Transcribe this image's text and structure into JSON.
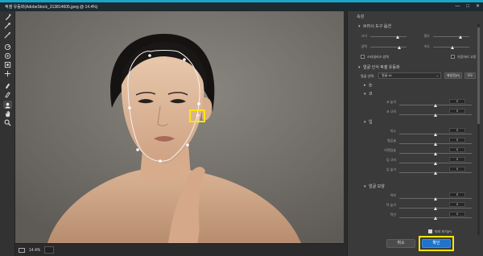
{
  "window": {
    "title": "픽셀 유동화(AdobeStock_313814605.jpeg @ 14.4%)",
    "controls": [
      "—",
      "□",
      "✕"
    ]
  },
  "toolbar": {
    "tools": [
      "forward-warp-icon",
      "reconstruct-icon",
      "smooth-icon",
      "twirl-icon",
      "pucker-icon",
      "bloat-icon",
      "push-left-icon",
      "freeze-mask-icon",
      "thaw-mask-icon",
      "face-tool-icon",
      "hand-icon",
      "zoom-icon"
    ],
    "active": "face-tool-icon"
  },
  "status": {
    "zoom": "14.4%"
  },
  "panel": {
    "header": "속성",
    "sections": {
      "brush_options": "브러시 도구 옵션",
      "face_aware": "얼굴 인식 픽셀 유동화",
      "eyes": "눈",
      "nose": "코",
      "mouth": "입",
      "face_shape": "얼굴 모양"
    },
    "brush_sliders": [
      {
        "label": "크기",
        "value": ""
      },
      {
        "label": "밀도",
        "value": ""
      },
      {
        "label": "압력",
        "value": ""
      },
      {
        "label": "속도",
        "value": ""
      }
    ],
    "stylus_label": "스타일러스 압력",
    "pin_edges_label": "가장자리 고정",
    "face_select": {
      "label": "얼굴 선택:",
      "value": "얼굴 #1",
      "reset": "재설정(R)",
      "all": "모두"
    },
    "nose_sliders": [
      {
        "label": "코 높이",
        "value": "0"
      },
      {
        "label": "코 너비",
        "value": "0"
      }
    ],
    "mouth_sliders": [
      {
        "label": "미소",
        "value": "0"
      },
      {
        "label": "윗입술",
        "value": "0"
      },
      {
        "label": "아랫입술",
        "value": "0"
      },
      {
        "label": "입 너비",
        "value": "0"
      },
      {
        "label": "입 높이",
        "value": "0"
      }
    ],
    "face_sliders": [
      {
        "label": "이마",
        "value": "0"
      },
      {
        "label": "턱 높이",
        "value": "0"
      },
      {
        "label": "턱선",
        "value": "0"
      }
    ],
    "preview_label": "미리 보기(P)",
    "cancel_label": "취소",
    "ok_label": "확인"
  }
}
